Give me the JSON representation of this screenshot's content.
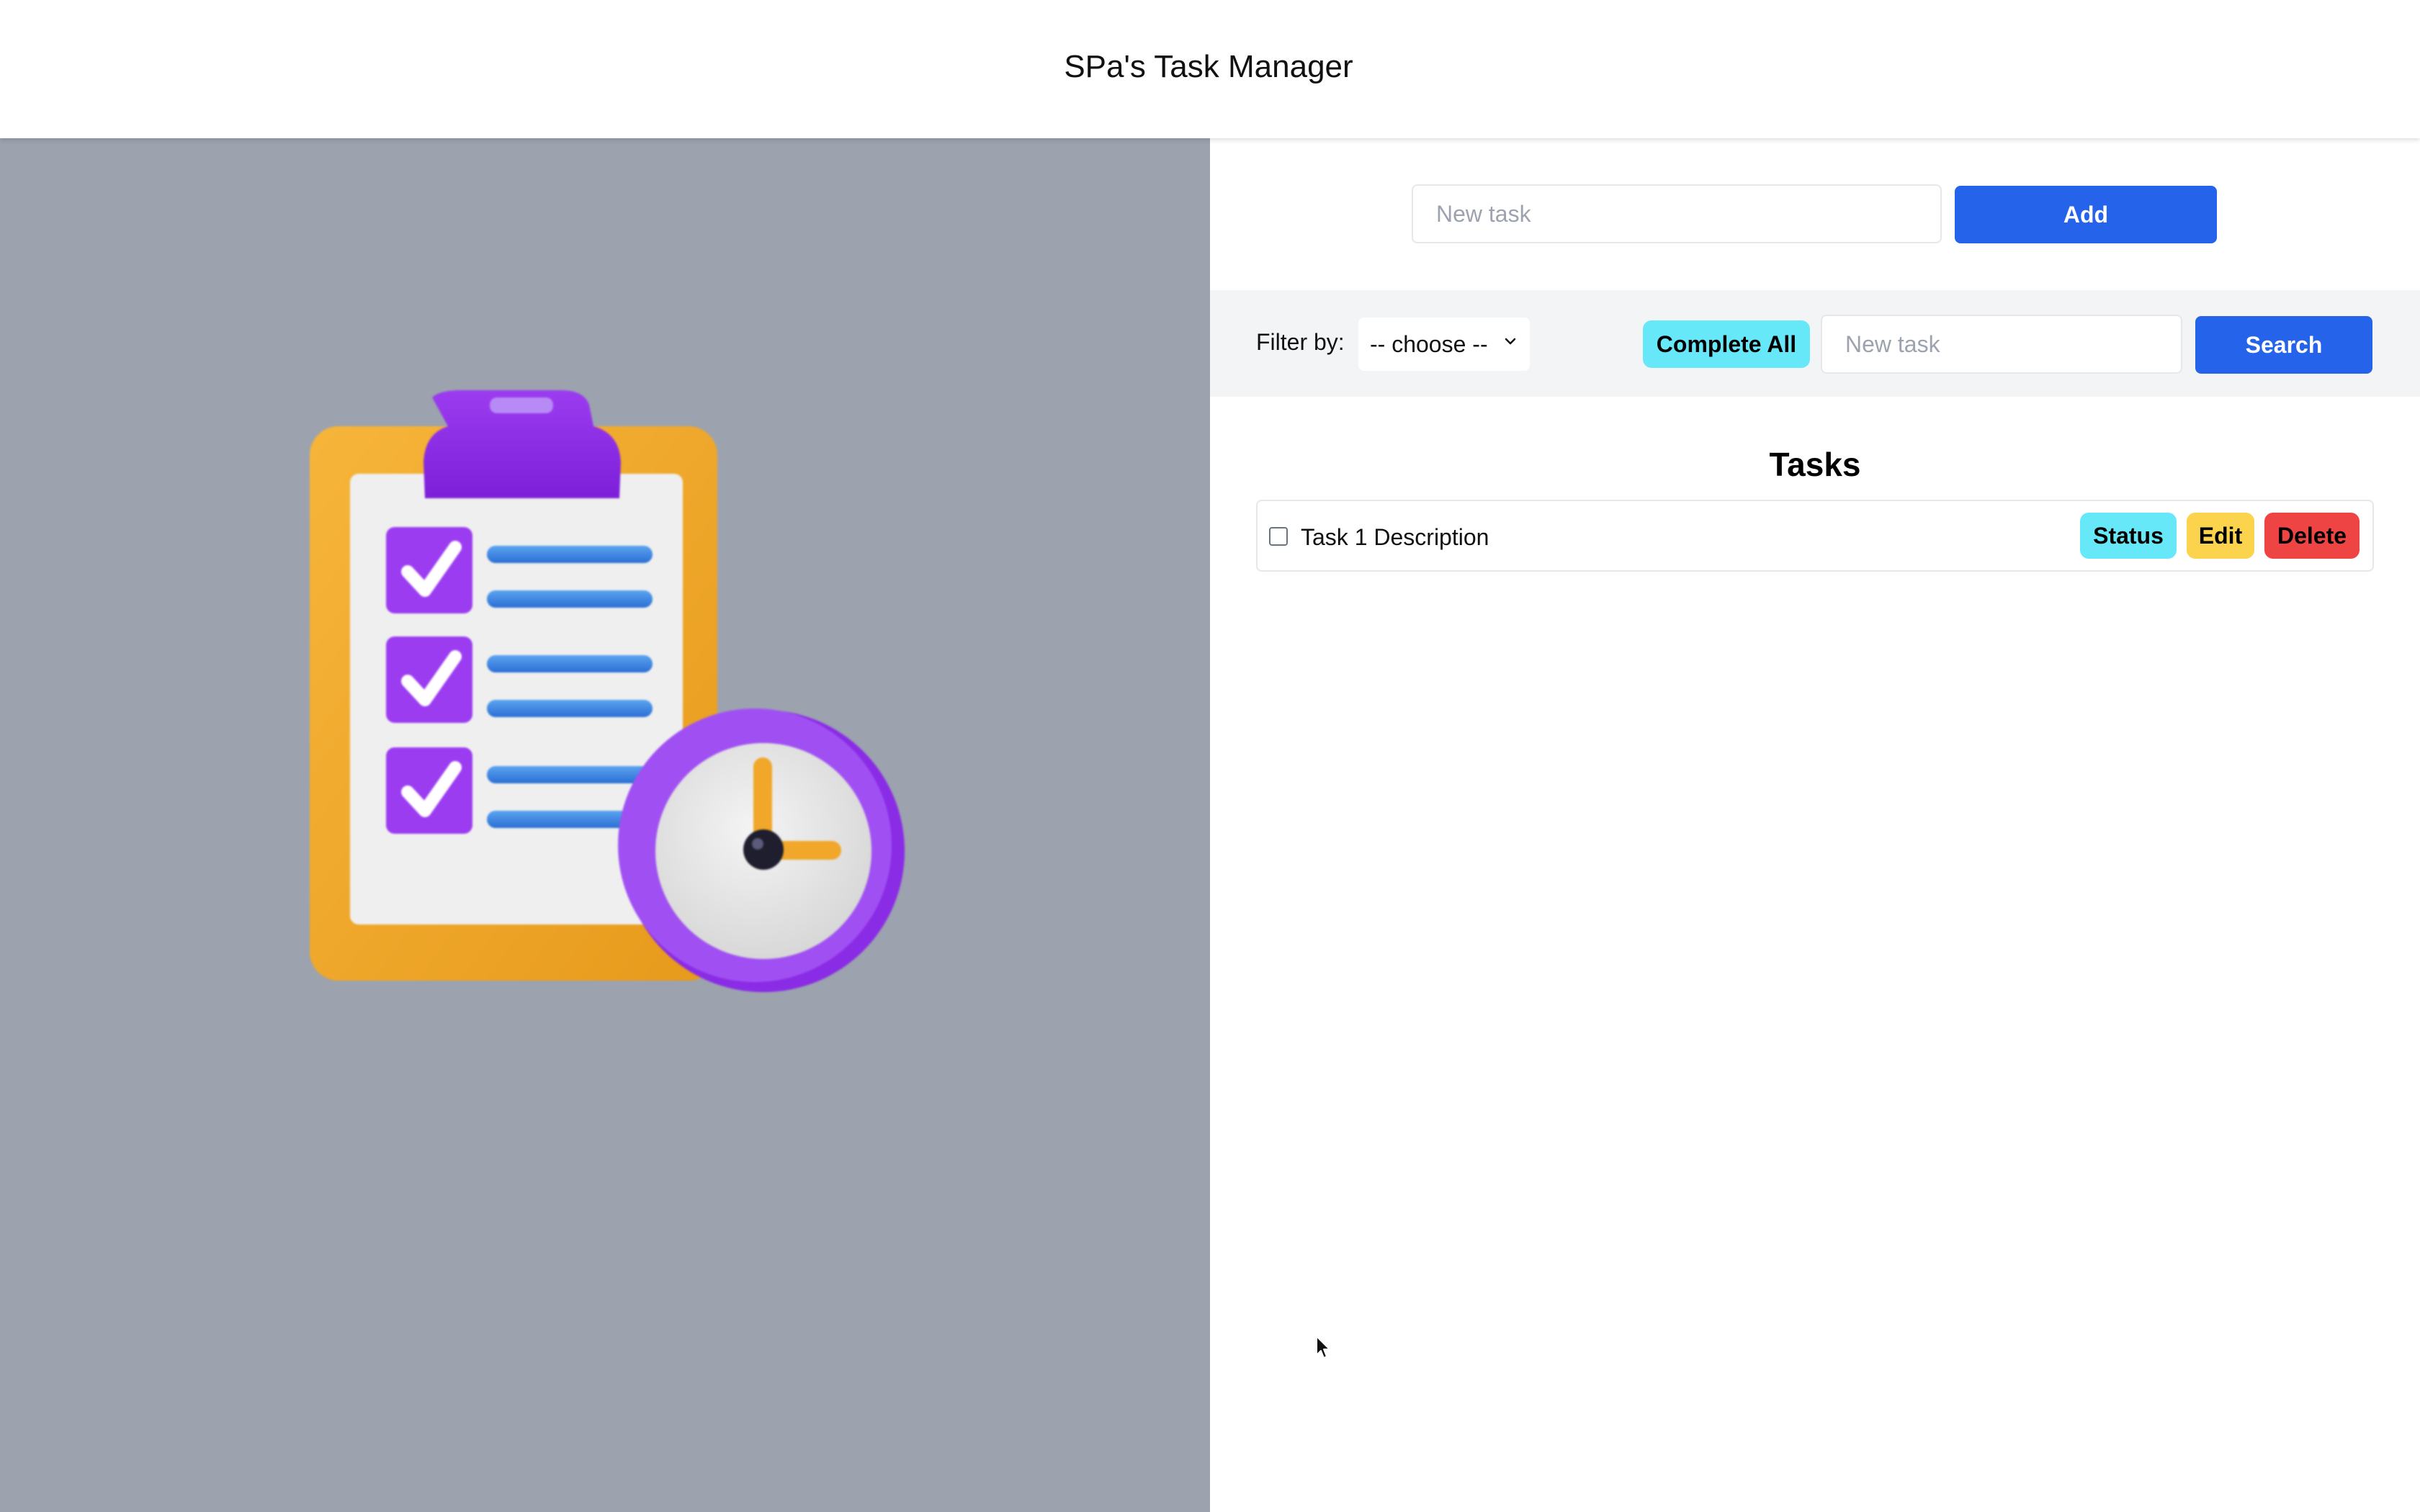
{
  "header": {
    "title": "SPa's Task Manager"
  },
  "add_task": {
    "placeholder": "New task",
    "value": "",
    "button_label": "Add"
  },
  "filter": {
    "label": "Filter by:",
    "selected": "-- choose --",
    "complete_all_label": "Complete All",
    "search_placeholder": "New task",
    "search_button_label": "Search"
  },
  "tasks": {
    "heading": "Tasks",
    "items": [
      {
        "description": "Task 1 Description",
        "checked": false,
        "status_label": "Status",
        "edit_label": "Edit",
        "delete_label": "Delete"
      }
    ]
  },
  "colors": {
    "primary": "#2563eb",
    "status": "#67e8f9",
    "edit": "#fcd34d",
    "delete": "#ef4444",
    "illustration_bg": "#9ca3af",
    "filter_bar_bg": "#f3f4f6"
  },
  "illustration": {
    "icon": "clipboard-checklist-clock-icon"
  }
}
